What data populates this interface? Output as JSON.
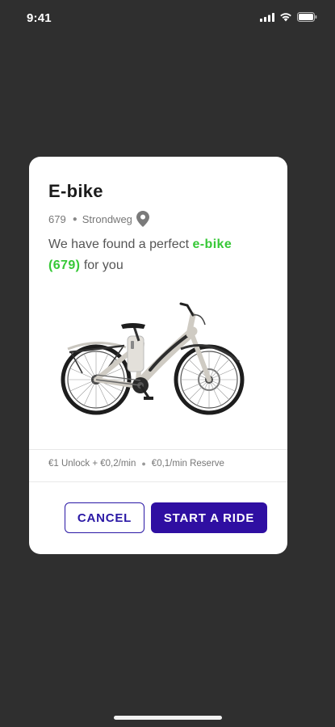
{
  "status_bar": {
    "time": "9:41"
  },
  "card": {
    "title": "E-bike",
    "bike_id": "679",
    "location": "Strondweg",
    "message_prefix": "We have found a perfect",
    "message_highlight_name": "e-bike",
    "message_highlight_id": "(679)",
    "message_suffix": "for you",
    "pricing": {
      "unlock": "€1 Unlock + €0,2/min",
      "reserve": "€0,1/min Reserve"
    },
    "buttons": {
      "cancel": "CANCEL",
      "start": "START A RIDE"
    }
  },
  "colors": {
    "background": "#2f2f2f",
    "accent": "#2f0fa2",
    "highlight": "#37c837"
  },
  "icons": [
    "signal-icon",
    "wifi-icon",
    "battery-icon",
    "location-pin-icon",
    "e-bike-image"
  ]
}
